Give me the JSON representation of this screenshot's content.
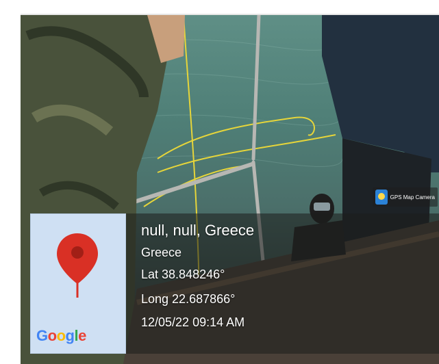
{
  "geotag": {
    "address": "null, null, Greece",
    "country": "Greece",
    "latitude": "Lat 38.848246°",
    "longitude": "Long 22.687866°",
    "datetime": "12/05/22 09:14 AM"
  },
  "map": {
    "logo_letters": [
      "G",
      "o",
      "o",
      "g",
      "l",
      "e"
    ],
    "pin_icon": "map-pin-icon",
    "pin_color": "#D93025",
    "tile_color": "#CFE0F3"
  },
  "app_badge": {
    "label": "GPS Map Camera",
    "icon": "gps-map-camera-icon"
  },
  "colors": {
    "water": "#5F8F86",
    "overlay": "#1C1E1C"
  }
}
